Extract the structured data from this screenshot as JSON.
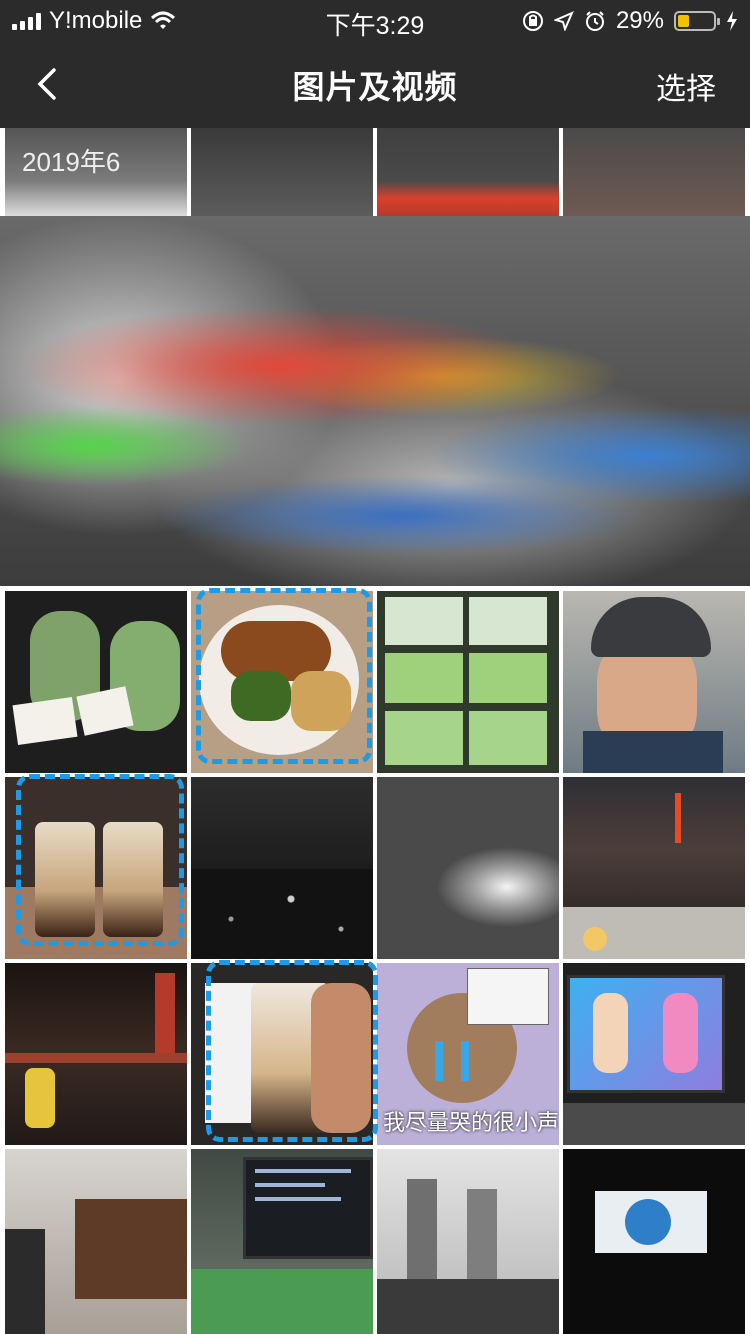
{
  "status_bar": {
    "carrier": "Y!mobile",
    "time": "下午3:29",
    "battery": "29%",
    "battery_level": 0.29
  },
  "nav": {
    "back_icon": "chevron-left-icon",
    "title": "图片及视频",
    "select_label": "选择"
  },
  "section": {
    "date": "2019年6"
  },
  "tiles": [
    {
      "name": "photo-blurred-header-1"
    },
    {
      "name": "photo-blurred-header-2"
    },
    {
      "name": "photo-blurred-header-3"
    },
    {
      "name": "photo-blurred-header-4"
    },
    {
      "name": "photo-blurred-large"
    },
    {
      "name": "photo-frog-figures"
    },
    {
      "name": "photo-fried-food-plate"
    },
    {
      "name": "photo-real-estate-listings"
    },
    {
      "name": "photo-selfie-helmet"
    },
    {
      "name": "photo-bubble-tea-pair"
    },
    {
      "name": "photo-night-city"
    },
    {
      "name": "photo-cloudy-sky"
    },
    {
      "name": "photo-tokyo-tower-night"
    },
    {
      "name": "photo-night-market"
    },
    {
      "name": "photo-bubble-tea-hand"
    },
    {
      "name": "photo-crying-mouse-meme",
      "caption": "我尽量哭的很小声"
    },
    {
      "name": "photo-tv-anime"
    },
    {
      "name": "photo-staircase-room"
    },
    {
      "name": "photo-computer-desk"
    },
    {
      "name": "photo-robot-lab"
    },
    {
      "name": "photo-dark-screen-logo"
    }
  ]
}
